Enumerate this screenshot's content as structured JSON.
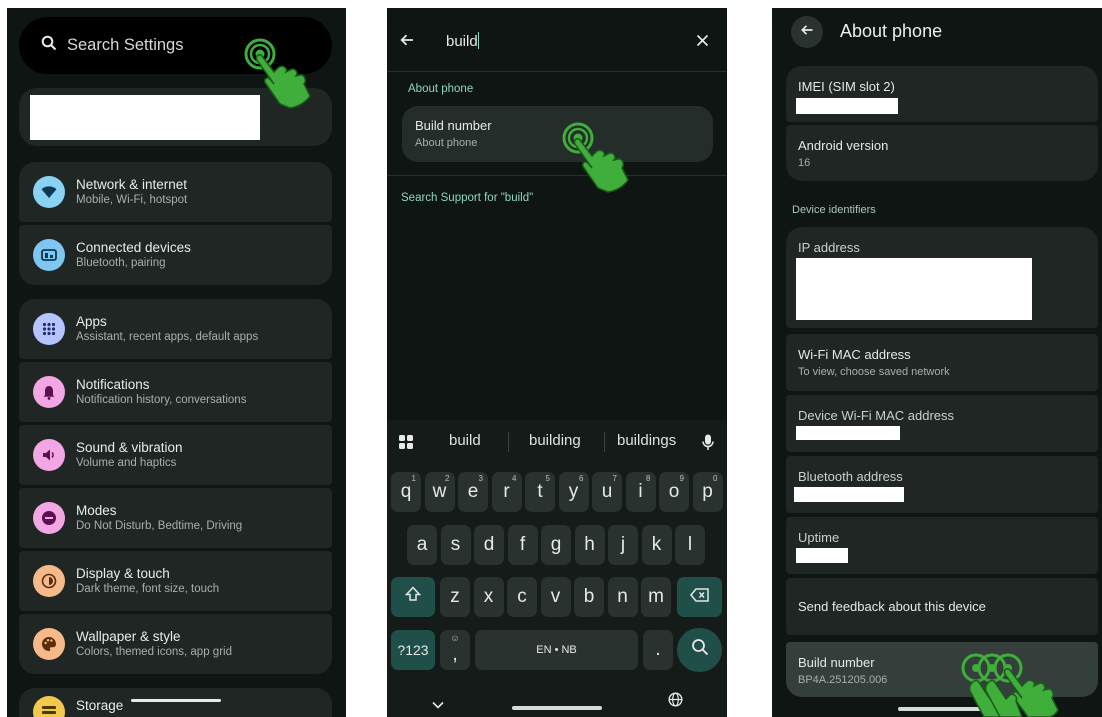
{
  "panel1": {
    "search_placeholder": "Search Settings",
    "items": [
      {
        "title": "Network & internet",
        "sub": "Mobile, Wi-Fi, hotspot",
        "icon": "wifi-icon",
        "color": "#8ad2f4",
        "fg": "#0b3a52"
      },
      {
        "title": "Connected devices",
        "sub": "Bluetooth, pairing",
        "icon": "connected-devices-icon",
        "color": "#7fc6f0",
        "fg": "#0b3a52"
      },
      {
        "title": "Apps",
        "sub": "Assistant, recent apps, default apps",
        "icon": "apps-grid-icon",
        "color": "#b5c4ff",
        "fg": "#22306a"
      },
      {
        "title": "Notifications",
        "sub": "Notification history, conversations",
        "icon": "bell-icon",
        "color": "#f3a6e4",
        "fg": "#5a1050"
      },
      {
        "title": "Sound & vibration",
        "sub": "Volume and haptics",
        "icon": "speaker-icon",
        "color": "#f3a6e4",
        "fg": "#5a1050"
      },
      {
        "title": "Modes",
        "sub": "Do Not Disturb, Bedtime, Driving",
        "icon": "minus-circle-icon",
        "color": "#f3a6e4",
        "fg": "#5a1050"
      },
      {
        "title": "Display & touch",
        "sub": "Dark theme, font size, touch",
        "icon": "brightness-icon",
        "color": "#f5b98a",
        "fg": "#5a2c08"
      },
      {
        "title": "Wallpaper & style",
        "sub": "Colors, themed icons, app grid",
        "icon": "palette-icon",
        "color": "#f5b98a",
        "fg": "#5a2c08"
      },
      {
        "title": "Storage",
        "sub": "",
        "icon": "storage-icon",
        "color": "#f2c94c",
        "fg": "#4a3a00"
      }
    ]
  },
  "panel2": {
    "query": "build",
    "section": "About phone",
    "result_title": "Build number",
    "result_sub": "About phone",
    "support_link": "Search Support for \"build\"",
    "suggestions": [
      "build",
      "building",
      "buildings"
    ],
    "row1": [
      "q",
      "w",
      "e",
      "r",
      "t",
      "y",
      "u",
      "i",
      "o",
      "p"
    ],
    "row1_digits": [
      "1",
      "2",
      "3",
      "4",
      "5",
      "6",
      "7",
      "8",
      "9",
      "0"
    ],
    "row2": [
      "a",
      "s",
      "d",
      "f",
      "g",
      "h",
      "j",
      "k",
      "l"
    ],
    "row3": [
      "z",
      "x",
      "c",
      "v",
      "b",
      "n",
      "m"
    ],
    "sym_key": "?123",
    "comma_key": ",",
    "space_label": "EN • NB",
    "period_key": "."
  },
  "panel3": {
    "title": "About phone",
    "imei_label": "IMEI (SIM slot 2)",
    "android_label": "Android version",
    "android_value": "16",
    "section": "Device identifiers",
    "ip_label": "IP address",
    "wifi_mac_label": "Wi-Fi MAC address",
    "wifi_mac_sub": "To view, choose saved network",
    "device_wifi_mac_label": "Device Wi-Fi MAC address",
    "bt_label": "Bluetooth address",
    "uptime_label": "Uptime",
    "feedback_label": "Send feedback about this device",
    "build_label": "Build number",
    "build_value": "BP4A.251205.006"
  },
  "colors": {
    "accent": "#8fd6c2",
    "hand": "#3fae3a"
  }
}
